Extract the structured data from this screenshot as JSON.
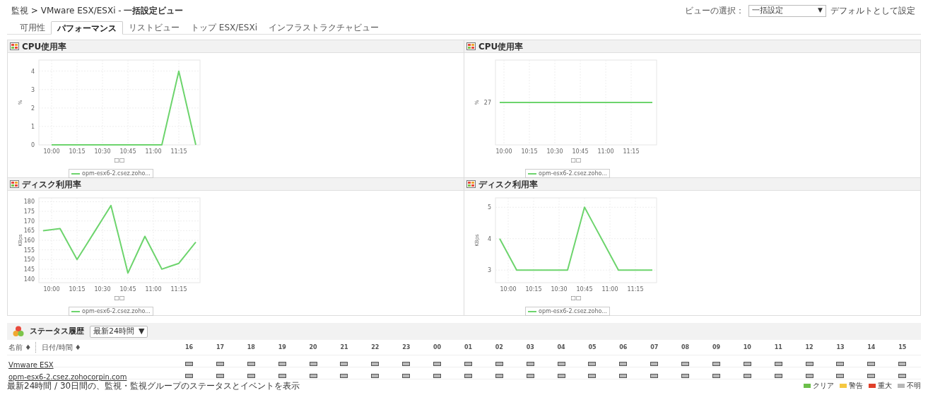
{
  "breadcrumb": "監視 > VMware ESX/ESXi - **一括設定ビュー**",
  "view_select": {
    "label": "ビューの選択：",
    "value": "一括設定",
    "arrow": "▼",
    "default_link": "デフォルトとして設定"
  },
  "tabs": [
    {
      "label": "可用性",
      "selected": false
    },
    {
      "label": "パフォーマンス",
      "selected": true
    },
    {
      "label": "リストビュー",
      "selected": false
    },
    {
      "label": "トップ ESX/ESXi",
      "selected": false
    },
    {
      "label": "インフラストラクチャビュー",
      "selected": false
    }
  ],
  "panels": [
    {
      "title": "CPU使用率",
      "chart_data": {
        "type": "line",
        "xlabel": "□□",
        "ylabel": "%",
        "grid": true,
        "categories": [
          null,
          "10:00",
          null,
          null,
          "10:15",
          null,
          null,
          "10:30",
          null,
          null,
          "10:45",
          null,
          null,
          "11:00",
          null,
          null,
          "11:15",
          null,
          null
        ],
        "series": [
          {
            "name": "opm-esx6-2.csez.zoho...",
            "color": "#6dd46d",
            "values": [
              null,
              0,
              0,
              0,
              0,
              0,
              0,
              0,
              0,
              0,
              0,
              0,
              0,
              0,
              0,
              2,
              4,
              2,
              0
            ]
          }
        ],
        "ylim": [
          0,
          4.6
        ],
        "yticks": [
          0,
          1,
          2,
          3,
          4
        ]
      }
    },
    {
      "title": "CPU使用率",
      "chart": {
        "xlabel": "□□",
        "ylabel": "%",
        "y_label": "27",
        "x_labels": [
          "10:00",
          "10:15",
          "10:30",
          "10:45",
          "11:00",
          "11:15"
        ],
        "legend": "opm-esx6-2.csez.zoho..."
      }
    },
    {
      "title": "ディスク利用率",
      "chart_data": {
        "type": "line",
        "xlabel": "□□",
        "ylabel": "KBps",
        "grid": true,
        "categories": [
          null,
          "10:00",
          null,
          null,
          "10:15",
          null,
          null,
          "10:30",
          null,
          null,
          "10:45",
          null,
          null,
          "11:00",
          null,
          null,
          "11:15",
          null,
          null
        ],
        "series": [
          {
            "name": "opm-esx6-2.csez.zoho...",
            "color": "#6dd46d",
            "values": [
              165,
              165.5,
              166,
              158,
              150,
              157,
              164,
              171,
              178,
              160.5,
              143,
              152.5,
              162,
              153.5,
              145,
              146.5,
              148,
              153.5,
              159
            ]
          }
        ],
        "ylim": [
          138,
          182
        ],
        "yticks": [
          140,
          145,
          150,
          155,
          160,
          165,
          170,
          175,
          180
        ]
      }
    },
    {
      "title": "ディスク利用率",
      "chart_data": {
        "type": "line",
        "xlabel": "□□",
        "ylabel": "KBps",
        "grid": true,
        "categories": [
          null,
          "10:00",
          null,
          null,
          "10:15",
          null,
          null,
          "10:30",
          null,
          null,
          "10:45",
          null,
          null,
          "11:00",
          null,
          null,
          "11:15",
          null,
          null
        ],
        "series": [
          {
            "name": "opm-esx6-2.csez.zoho...",
            "color": "#6dd46d",
            "values": [
              4,
              3.5,
              3,
              3,
              3,
              3,
              3,
              3,
              3,
              4,
              5,
              4.5,
              4,
              3.5,
              3,
              3,
              3,
              3,
              3
            ]
          }
        ],
        "ylim": [
          2.6,
          5.3
        ],
        "yticks": [
          3,
          4,
          5
        ]
      }
    }
  ],
  "status_history": {
    "title": "ステータス履歴",
    "period": "最新24時間",
    "arrow": "▼",
    "name_header": "名前 ♦",
    "date_header": "日付/時間 ♦",
    "hours": [
      "16",
      "17",
      "18",
      "19",
      "20",
      "21",
      "22",
      "23",
      "00",
      "01",
      "02",
      "03",
      "04",
      "05",
      "06",
      "07",
      "08",
      "09",
      "10",
      "11",
      "12",
      "13",
      "14",
      "15"
    ],
    "rows": [
      {
        "name": "Vmware ESX",
        "cells": [
          {
            "color": "#b8b8b8"
          },
          {
            "color": "#b8b8b8"
          },
          {
            "color": "#b8b8b8"
          },
          {
            "color": "#b8b8b8"
          },
          {
            "color": "#b8b8b8"
          },
          {
            "color": "#b8b8b8"
          },
          {
            "color": "#b8b8b8"
          },
          {
            "color": "#b8b8b8"
          },
          {
            "color": "#b8b8b8"
          },
          {
            "color": "#b8b8b8"
          },
          {
            "color": "#b8b8b8"
          },
          {
            "color": "#b8b8b8"
          },
          {
            "color": "#b8b8b8"
          },
          {
            "color": "#b8b8b8"
          },
          {
            "color": "#b8b8b8"
          },
          {
            "color": "#b8b8b8"
          },
          {
            "color": "#b8b8b8"
          },
          {
            "color": "#b8b8b8"
          },
          {
            "color": "#b8b8b8"
          },
          {
            "color": "#b8b8b8"
          },
          {
            "color": "#b8b8b8"
          },
          {
            "color": "#b8b8b8"
          },
          {
            "color": "#b8b8b8"
          },
          {
            "color": "#b8b8b8"
          }
        ]
      },
      {
        "name": "opm-esx6-2.csez.zohocorpin.com",
        "cells": [
          {
            "color": "#b8b8b8"
          },
          {
            "color": "#b8b8b8"
          },
          {
            "color": "#b8b8b8"
          },
          {
            "color": "#b8b8b8"
          },
          {
            "color": "#b8b8b8"
          },
          {
            "color": "#b8b8b8"
          },
          {
            "color": "#b8b8b8"
          },
          {
            "color": "#b8b8b8"
          },
          {
            "color": "#b8b8b8"
          },
          {
            "color": "#b8b8b8"
          },
          {
            "color": "#b8b8b8"
          },
          {
            "color": "#b8b8b8"
          },
          {
            "color": "#b8b8b8"
          },
          {
            "color": "#b8b8b8"
          },
          {
            "color": "#b8b8b8"
          },
          {
            "color": "#b8b8b8"
          },
          {
            "color": "#b8b8b8"
          },
          {
            "color": "#b8b8b8"
          },
          {
            "color": "#b8b8b8"
          },
          {
            "color": "#b8b8b8"
          },
          {
            "color": "#b8b8b8"
          },
          {
            "color": "#b8b8b8"
          },
          {
            "color": "#b8b8b8"
          },
          {
            "color": "#b8b8b8"
          }
        ]
      }
    ],
    "footer": "最新24時間 / 30日間の、監視・監視グループのステータスとイベントを表示",
    "legend": [
      {
        "label": "クリア",
        "color": "#6cbf4a"
      },
      {
        "label": "警告",
        "color": "#f5c842"
      },
      {
        "label": "重大",
        "color": "#e0402a"
      },
      {
        "label": "不明",
        "color": "#b8b8b8"
      }
    ]
  }
}
